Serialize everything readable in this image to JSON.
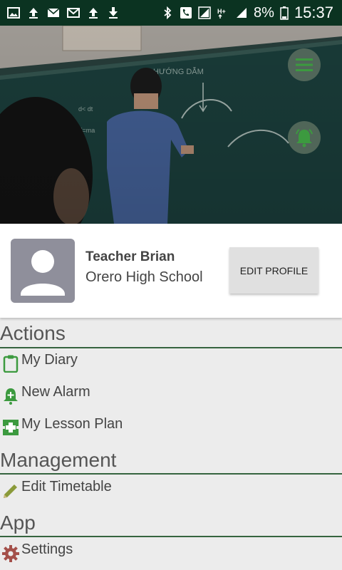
{
  "status_bar": {
    "battery": "8%",
    "time": "15:37"
  },
  "profile": {
    "name": "Teacher Brian",
    "school": "Orero High School",
    "edit_button": "EDIT PROFILE"
  },
  "menu": {
    "sections": [
      {
        "title": "Actions",
        "items": [
          {
            "label": "My Diary",
            "icon": "clipboard-icon"
          },
          {
            "label": "New Alarm",
            "icon": "add-alarm-icon"
          },
          {
            "label": "My Lesson Plan",
            "icon": "lesson-plan-icon"
          }
        ]
      },
      {
        "title": "Management",
        "items": [
          {
            "label": "Edit Timetable",
            "icon": "pencil-icon"
          }
        ]
      },
      {
        "title": "App",
        "items": [
          {
            "label": "Settings",
            "icon": "gear-icon"
          }
        ]
      }
    ]
  },
  "colors": {
    "status_bar": "#0b3321",
    "accent_green": "#36643f",
    "icon_green": "#3c9a3f"
  }
}
